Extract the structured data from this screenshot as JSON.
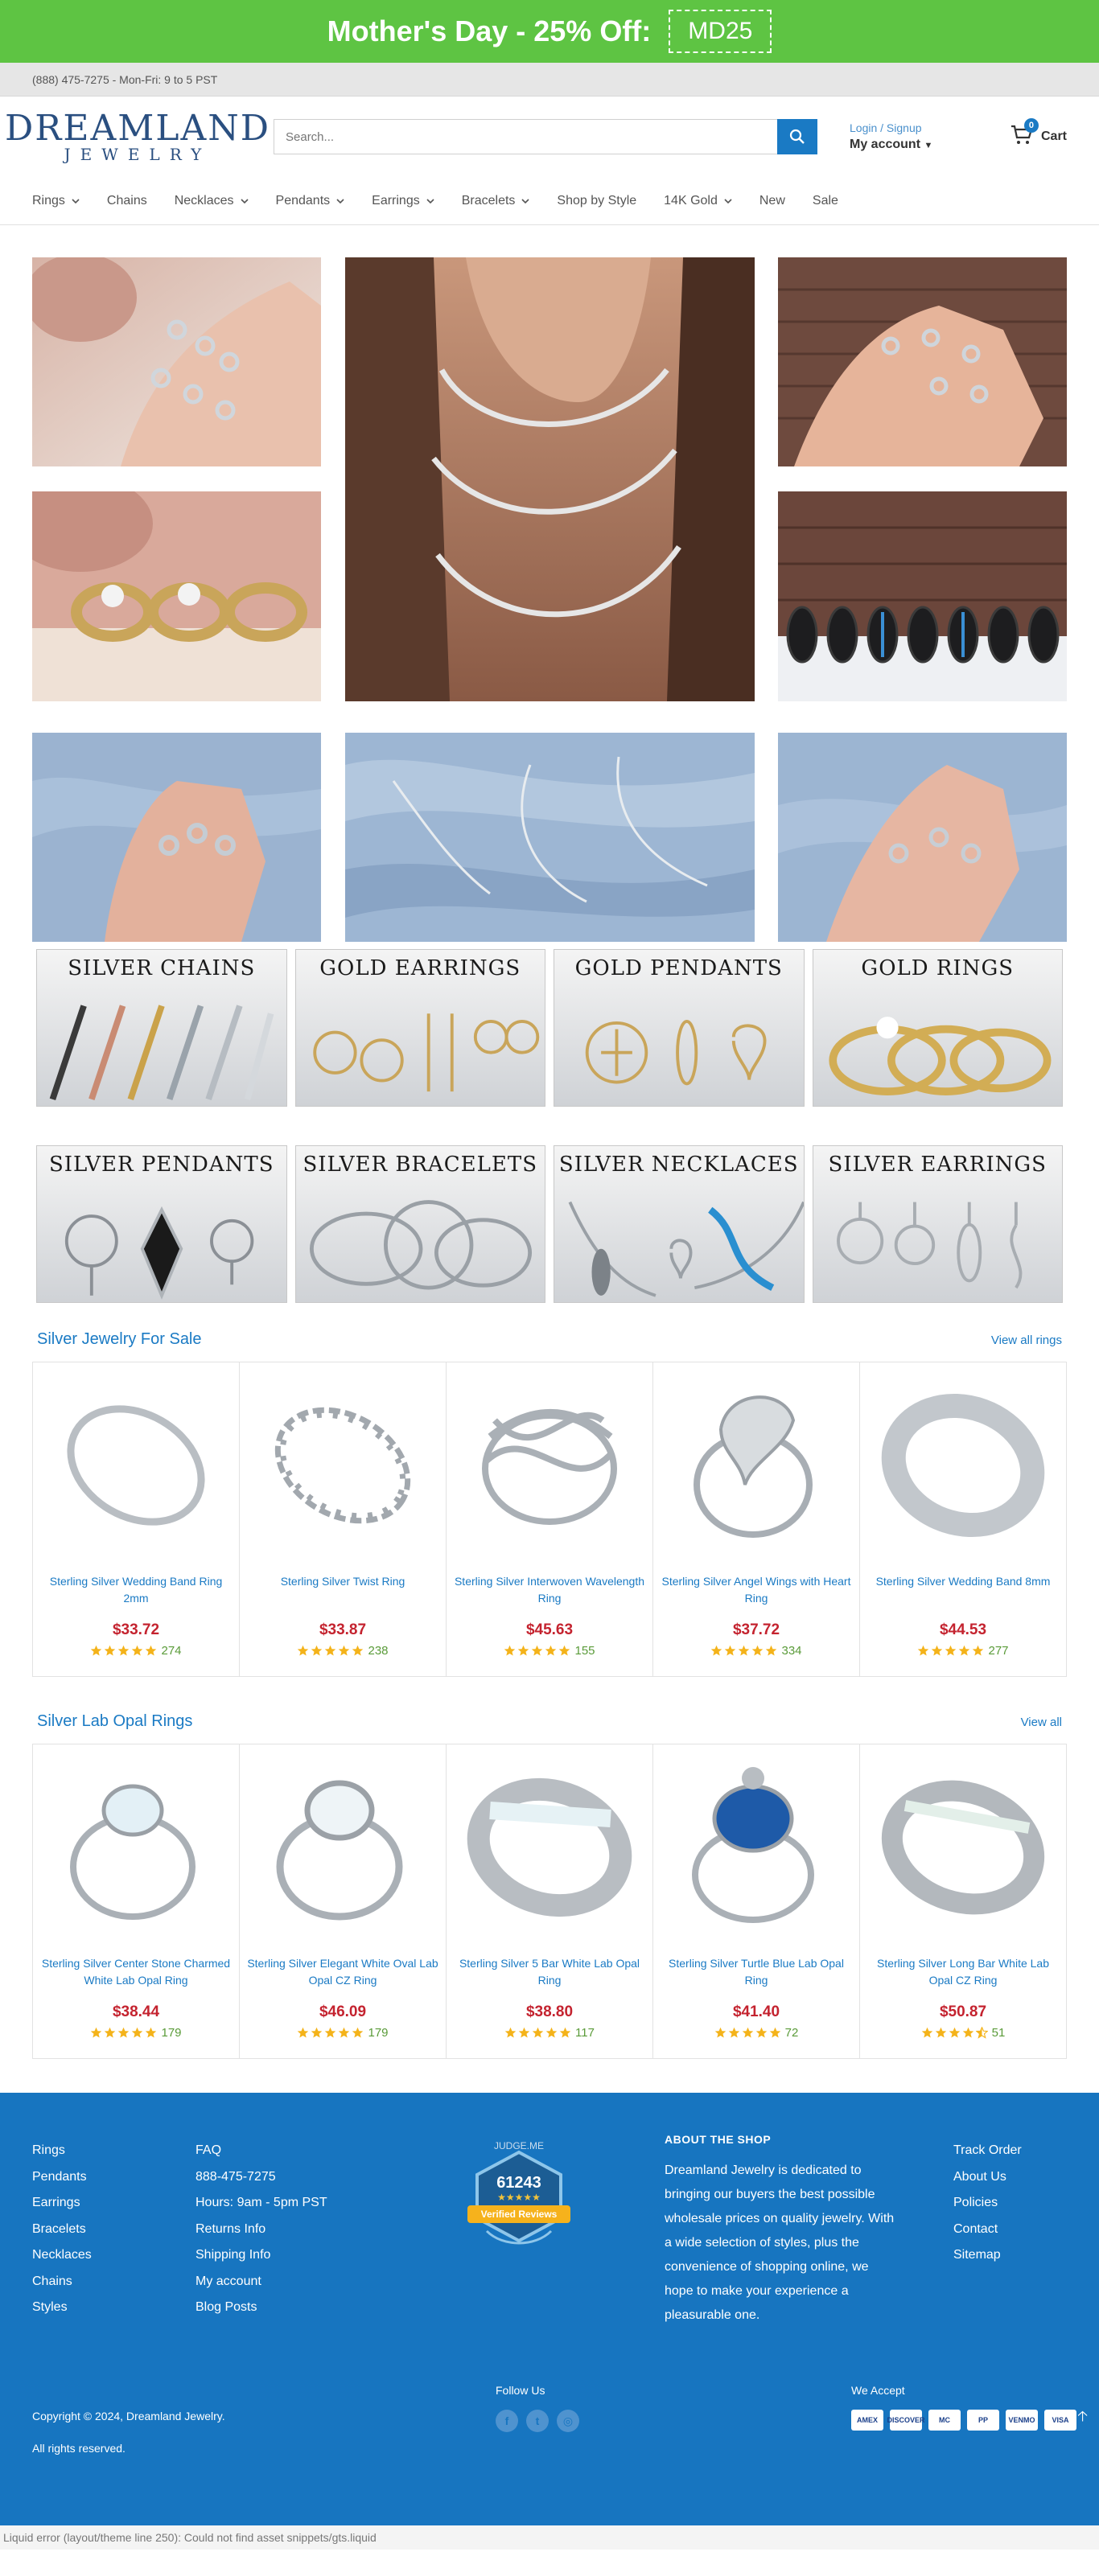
{
  "promo": {
    "text": "Mother's Day - 25% Off:",
    "code": "MD25"
  },
  "topbar": {
    "phone": "(888) 475-7275 - Mon-Fri: 9 to 5 PST"
  },
  "header": {
    "logo_top": "DREAMLAND",
    "logo_bottom": "JEWELRY",
    "search_placeholder": "Search...",
    "login": "Login / Signup",
    "my_account": "My account",
    "cart_label": "Cart",
    "cart_count": "0"
  },
  "nav": [
    {
      "label": "Rings",
      "dropdown": true
    },
    {
      "label": "Chains",
      "dropdown": false
    },
    {
      "label": "Necklaces",
      "dropdown": true
    },
    {
      "label": "Pendants",
      "dropdown": true
    },
    {
      "label": "Earrings",
      "dropdown": true
    },
    {
      "label": "Bracelets",
      "dropdown": true
    },
    {
      "label": "Shop by Style",
      "dropdown": false
    },
    {
      "label": "14K Gold",
      "dropdown": true
    },
    {
      "label": "New",
      "dropdown": false
    },
    {
      "label": "Sale",
      "dropdown": false
    }
  ],
  "categories": {
    "row1": [
      {
        "word1": "SILVER",
        "word2": "CHAINS"
      },
      {
        "word1": "GOLD",
        "word2": "EARRINGS"
      },
      {
        "word1": "GOLD",
        "word2": "PENDANTS"
      },
      {
        "word1": "GOLD",
        "word2": "RINGS"
      }
    ],
    "row2": [
      {
        "word1": "SILVER",
        "word2": "PENDANTS"
      },
      {
        "word1": "SILVER",
        "word2": "BRACELETS"
      },
      {
        "word1": "SILVER",
        "word2": "NECKLACES"
      },
      {
        "word1": "SILVER",
        "word2": "EARRINGS"
      }
    ]
  },
  "sections": [
    {
      "title": "Silver Jewelry For Sale",
      "link": "View all rings",
      "products": [
        {
          "name": "Sterling Silver Wedding Band Ring 2mm",
          "price": "$33.72",
          "rating": 5,
          "reviews": "274"
        },
        {
          "name": "Sterling Silver Twist Ring",
          "price": "$33.87",
          "rating": 5,
          "reviews": "238"
        },
        {
          "name": "Sterling Silver Interwoven Wavelength Ring",
          "price": "$45.63",
          "rating": 5,
          "reviews": "155"
        },
        {
          "name": "Sterling Silver Angel Wings with Heart Ring",
          "price": "$37.72",
          "rating": 5,
          "reviews": "334"
        },
        {
          "name": "Sterling Silver Wedding Band 8mm",
          "price": "$44.53",
          "rating": 5,
          "reviews": "277"
        }
      ]
    },
    {
      "title": "Silver Lab Opal Rings",
      "link": "View all",
      "products": [
        {
          "name": "Sterling Silver Center Stone Charmed White Lab Opal Ring",
          "price": "$38.44",
          "rating": 5,
          "reviews": "179"
        },
        {
          "name": "Sterling Silver Elegant White Oval Lab Opal CZ Ring",
          "price": "$46.09",
          "rating": 5,
          "reviews": "179"
        },
        {
          "name": "Sterling Silver 5 Bar White Lab Opal Ring",
          "price": "$38.80",
          "rating": 5,
          "reviews": "117"
        },
        {
          "name": "Sterling Silver Turtle Blue Lab Opal Ring",
          "price": "$41.40",
          "rating": 5,
          "reviews": "72"
        },
        {
          "name": "Sterling Silver Long Bar White Lab Opal CZ Ring",
          "price": "$50.87",
          "rating": 4.5,
          "reviews": "51"
        }
      ]
    }
  ],
  "footer": {
    "col1": [
      "Rings",
      "Pendants",
      "Earrings",
      "Bracelets",
      "Necklaces",
      "Chains",
      "Styles"
    ],
    "col2": [
      "FAQ",
      "888-475-7275",
      "Hours: 9am - 5pm PST",
      "Returns Info",
      "Shipping Info",
      "My account",
      "Blog Posts"
    ],
    "badge": {
      "top": "JUDGE.ME",
      "count": "61243",
      "label": "Verified Reviews"
    },
    "about_title": "ABOUT THE SHOP",
    "about_text": "Dreamland Jewelry is dedicated to bringing our buyers the best possible wholesale prices on quality jewelry. With a wide selection of styles, plus the convenience of shopping online, we hope to make your experience a pleasurable one.",
    "col4": [
      "Track Order",
      "About Us",
      "Policies",
      "Contact",
      "Sitemap"
    ],
    "copyright": "Copyright © 2024, Dreamland Jewelry.",
    "rights": "All rights reserved.",
    "follow_us": "Follow Us",
    "we_accept": "We Accept",
    "payments": [
      "AMEX",
      "DISCOVER",
      "MC",
      "PP",
      "VENMO",
      "VISA"
    ]
  },
  "error_text": "Liquid error (layout/theme line 250): Could not find asset snippets/gts.liquid",
  "colors": {
    "promo_green": "#5ec443",
    "brand_blue": "#1a7ac4",
    "footer_blue": "#1775c0",
    "price_red": "#c4232f",
    "star_gold": "#f4b31a"
  }
}
